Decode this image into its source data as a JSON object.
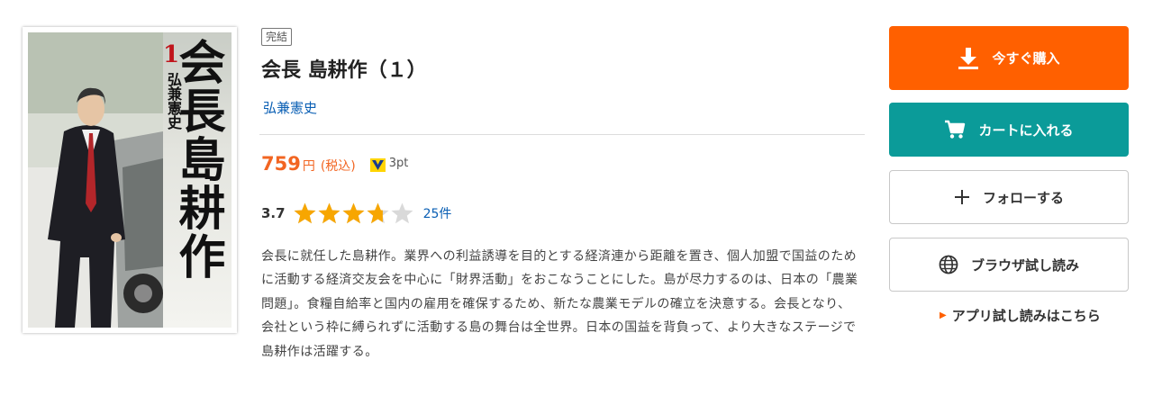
{
  "cover": {
    "title": "会長島耕作",
    "volume": "1",
    "author": "弘兼憲史"
  },
  "product": {
    "status_badge": "完結",
    "title": "会長 島耕作（１）",
    "author": "弘兼憲史",
    "price": "759",
    "price_unit": "円",
    "tax_label": "(税込)",
    "points": "3pt",
    "rating": "3.7",
    "rating_value": 3.7,
    "rating_max": 5,
    "review_count": "25件",
    "description": "会長に就任した島耕作。業界への利益誘導を目的とする経済連から距離を置き、個人加盟で国益のために活動する経済交友会を中心に「財界活動」をおこなうことにした。島が尽力するのは、日本の「農業問題」。食糧自給率と国内の雇用を確保するため、新たな農業モデルの確立を決意する。会長となり、会社という枠に縛られずに活動する島の舞台は全世界。日本の国益を背負って、より大きなステージで島耕作は活躍する。"
  },
  "actions": {
    "buy_label": "今すぐ購入",
    "cart_label": "カートに入れる",
    "follow_label": "フォローする",
    "preview_label": "ブラウザ試し読み",
    "app_preview_label": "アプリ試し読みはこちら"
  },
  "colors": {
    "buy": "#ff6000",
    "cart": "#0b9b99",
    "price": "#f26522",
    "link": "#0a5fb4",
    "star_on": "#f7a600",
    "star_off": "#d9d9d9"
  },
  "icons": {
    "buy": "download-arrow-icon",
    "cart": "cart-icon",
    "follow": "plus-icon",
    "preview": "globe-icon",
    "app": "triangle-right-icon",
    "points": "v-point-icon"
  }
}
